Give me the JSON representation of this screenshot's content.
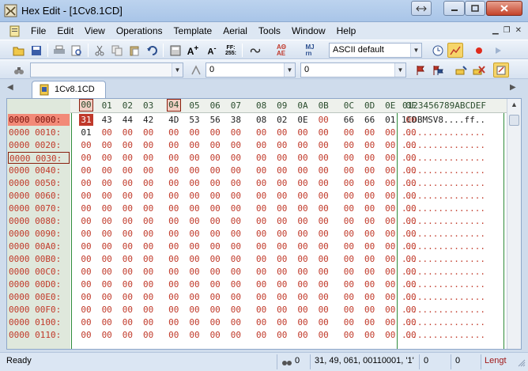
{
  "window": {
    "title": "Hex Edit - [1Cv8.1CD]"
  },
  "menu": [
    "File",
    "Edit",
    "View",
    "Operations",
    "Template",
    "Aerial",
    "Tools",
    "Window",
    "Help"
  ],
  "toolbar": {
    "charset_combo": "ASCII default",
    "nav_combo1": "0",
    "nav_combo2": "0"
  },
  "tab": {
    "label": "1Cv8.1CD"
  },
  "hex": {
    "columns": [
      "00",
      "01",
      "02",
      "03",
      "04",
      "05",
      "06",
      "07",
      "08",
      "09",
      "0A",
      "0B",
      "0C",
      "0D",
      "0E",
      "0F"
    ],
    "ascii_header": "0123456789ABCDEF",
    "rows": [
      {
        "addr": "0000 0000:",
        "bytes": [
          "31",
          "43",
          "44",
          "42",
          "4D",
          "53",
          "56",
          "38",
          "08",
          "02",
          "0E",
          "00",
          "66",
          "66",
          "01",
          "00"
        ],
        "ascii": "1CDBMSV8....ff.."
      },
      {
        "addr": "0000 0010:",
        "bytes": [
          "01",
          "00",
          "00",
          "00",
          "00",
          "00",
          "00",
          "00",
          "00",
          "00",
          "00",
          "00",
          "00",
          "00",
          "00",
          "00"
        ],
        "ascii": "................"
      },
      {
        "addr": "0000 0020:",
        "bytes": [
          "00",
          "00",
          "00",
          "00",
          "00",
          "00",
          "00",
          "00",
          "00",
          "00",
          "00",
          "00",
          "00",
          "00",
          "00",
          "00"
        ],
        "ascii": "................"
      },
      {
        "addr": "0000 0030:",
        "bytes": [
          "00",
          "00",
          "00",
          "00",
          "00",
          "00",
          "00",
          "00",
          "00",
          "00",
          "00",
          "00",
          "00",
          "00",
          "00",
          "00"
        ],
        "ascii": "................"
      },
      {
        "addr": "0000 0040:",
        "bytes": [
          "00",
          "00",
          "00",
          "00",
          "00",
          "00",
          "00",
          "00",
          "00",
          "00",
          "00",
          "00",
          "00",
          "00",
          "00",
          "00"
        ],
        "ascii": "................"
      },
      {
        "addr": "0000 0050:",
        "bytes": [
          "00",
          "00",
          "00",
          "00",
          "00",
          "00",
          "00",
          "00",
          "00",
          "00",
          "00",
          "00",
          "00",
          "00",
          "00",
          "00"
        ],
        "ascii": "................"
      },
      {
        "addr": "0000 0060:",
        "bytes": [
          "00",
          "00",
          "00",
          "00",
          "00",
          "00",
          "00",
          "00",
          "00",
          "00",
          "00",
          "00",
          "00",
          "00",
          "00",
          "00"
        ],
        "ascii": "................"
      },
      {
        "addr": "0000 0070:",
        "bytes": [
          "00",
          "00",
          "00",
          "00",
          "00",
          "00",
          "00",
          "00",
          "00",
          "00",
          "00",
          "00",
          "00",
          "00",
          "00",
          "00"
        ],
        "ascii": "................"
      },
      {
        "addr": "0000 0080:",
        "bytes": [
          "00",
          "00",
          "00",
          "00",
          "00",
          "00",
          "00",
          "00",
          "00",
          "00",
          "00",
          "00",
          "00",
          "00",
          "00",
          "00"
        ],
        "ascii": "................"
      },
      {
        "addr": "0000 0090:",
        "bytes": [
          "00",
          "00",
          "00",
          "00",
          "00",
          "00",
          "00",
          "00",
          "00",
          "00",
          "00",
          "00",
          "00",
          "00",
          "00",
          "00"
        ],
        "ascii": "................"
      },
      {
        "addr": "0000 00A0:",
        "bytes": [
          "00",
          "00",
          "00",
          "00",
          "00",
          "00",
          "00",
          "00",
          "00",
          "00",
          "00",
          "00",
          "00",
          "00",
          "00",
          "00"
        ],
        "ascii": "................"
      },
      {
        "addr": "0000 00B0:",
        "bytes": [
          "00",
          "00",
          "00",
          "00",
          "00",
          "00",
          "00",
          "00",
          "00",
          "00",
          "00",
          "00",
          "00",
          "00",
          "00",
          "00"
        ],
        "ascii": "................"
      },
      {
        "addr": "0000 00C0:",
        "bytes": [
          "00",
          "00",
          "00",
          "00",
          "00",
          "00",
          "00",
          "00",
          "00",
          "00",
          "00",
          "00",
          "00",
          "00",
          "00",
          "00"
        ],
        "ascii": "................"
      },
      {
        "addr": "0000 00D0:",
        "bytes": [
          "00",
          "00",
          "00",
          "00",
          "00",
          "00",
          "00",
          "00",
          "00",
          "00",
          "00",
          "00",
          "00",
          "00",
          "00",
          "00"
        ],
        "ascii": "................"
      },
      {
        "addr": "0000 00E0:",
        "bytes": [
          "00",
          "00",
          "00",
          "00",
          "00",
          "00",
          "00",
          "00",
          "00",
          "00",
          "00",
          "00",
          "00",
          "00",
          "00",
          "00"
        ],
        "ascii": "................"
      },
      {
        "addr": "0000 00F0:",
        "bytes": [
          "00",
          "00",
          "00",
          "00",
          "00",
          "00",
          "00",
          "00",
          "00",
          "00",
          "00",
          "00",
          "00",
          "00",
          "00",
          "00"
        ],
        "ascii": "................"
      },
      {
        "addr": "0000 0100:",
        "bytes": [
          "00",
          "00",
          "00",
          "00",
          "00",
          "00",
          "00",
          "00",
          "00",
          "00",
          "00",
          "00",
          "00",
          "00",
          "00",
          "00"
        ],
        "ascii": "................"
      },
      {
        "addr": "0000 0110:",
        "bytes": [
          "00",
          "00",
          "00",
          "00",
          "00",
          "00",
          "00",
          "00",
          "00",
          "00",
          "00",
          "00",
          "00",
          "00",
          "00",
          "00"
        ],
        "ascii": "................"
      }
    ]
  },
  "status": {
    "ready": "Ready",
    "sel_count": "0",
    "char_info": "31, 49, 061, 00110001, '1'",
    "value1": "0",
    "value2": "0",
    "length_label": "Lengt"
  },
  "colors": {
    "accent": "#c0392b",
    "address_bg": "#dfe8dc",
    "zero_byte": "#c13a2a"
  }
}
